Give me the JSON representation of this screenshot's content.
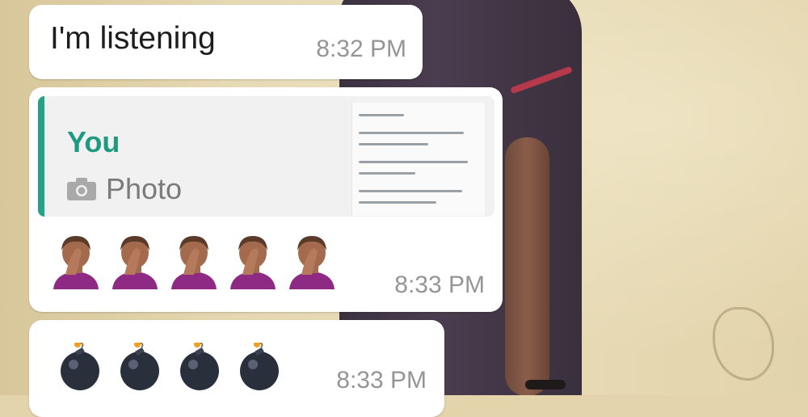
{
  "messages": [
    {
      "text": "I'm listening",
      "time": "8:32 PM"
    },
    {
      "quote": {
        "author": "You",
        "type_label": "Photo",
        "icon": "camera-icon"
      },
      "emojis": [
        "person-facepalming",
        "person-facepalming",
        "person-facepalming",
        "person-facepalming",
        "person-facepalming"
      ],
      "time": "8:33 PM"
    },
    {
      "emojis": [
        "bomb",
        "bomb",
        "bomb",
        "bomb"
      ],
      "time": "8:33 PM"
    }
  ],
  "colors": {
    "quote_accent": "#25a187",
    "quote_author": "#1e9a80",
    "timestamp": "#959595",
    "bubble": "#ffffff"
  }
}
